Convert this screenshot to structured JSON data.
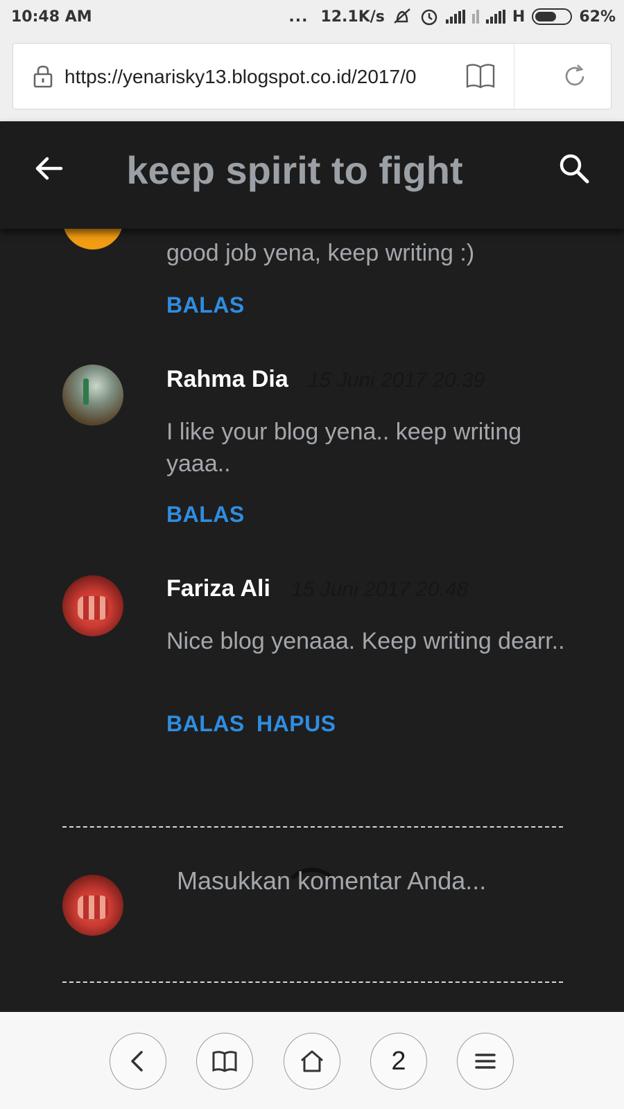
{
  "status_bar": {
    "time": "10:48 AM",
    "dots": "...",
    "speed": "12.1K/s",
    "network": "H",
    "battery": "62%",
    "battery_level": 0.62
  },
  "browser": {
    "url": "https://yenarisky13.blogspot.co.id/2017/0",
    "icons": [
      "lock-icon",
      "reader-mode-icon",
      "reload-icon"
    ]
  },
  "header": {
    "title": "keep spirit to fight",
    "icons": [
      "back-arrow-icon",
      "search-icon"
    ]
  },
  "comments": [
    {
      "author": "",
      "date": "",
      "text": "good job yena, keep writing :)",
      "actions": [
        "BALAS"
      ]
    },
    {
      "author": "Rahma Dia",
      "date": "15 Juni 2017 20.39",
      "text": "I like your blog yena.. keep writing yaaa..",
      "actions": [
        "BALAS"
      ]
    },
    {
      "author": "Fariza Ali",
      "date": "15 Juni 2017 20.48",
      "text": "Nice blog yenaaa. Keep writing dearr..",
      "actions": [
        "BALAS",
        "HAPUS"
      ]
    }
  ],
  "compose": {
    "placeholder": "Masukkan komentar Anda..."
  },
  "bottom_nav": {
    "tab_count": "2",
    "icons": [
      "back-icon",
      "bookmarks-icon",
      "home-icon",
      "tabs-button",
      "menu-icon"
    ]
  },
  "colors": {
    "background": "#1e1e1e",
    "header": "#1c1c1c",
    "title": "#9aa0a6",
    "link": "#2f8de0",
    "body_text": "#a4a8ad"
  }
}
